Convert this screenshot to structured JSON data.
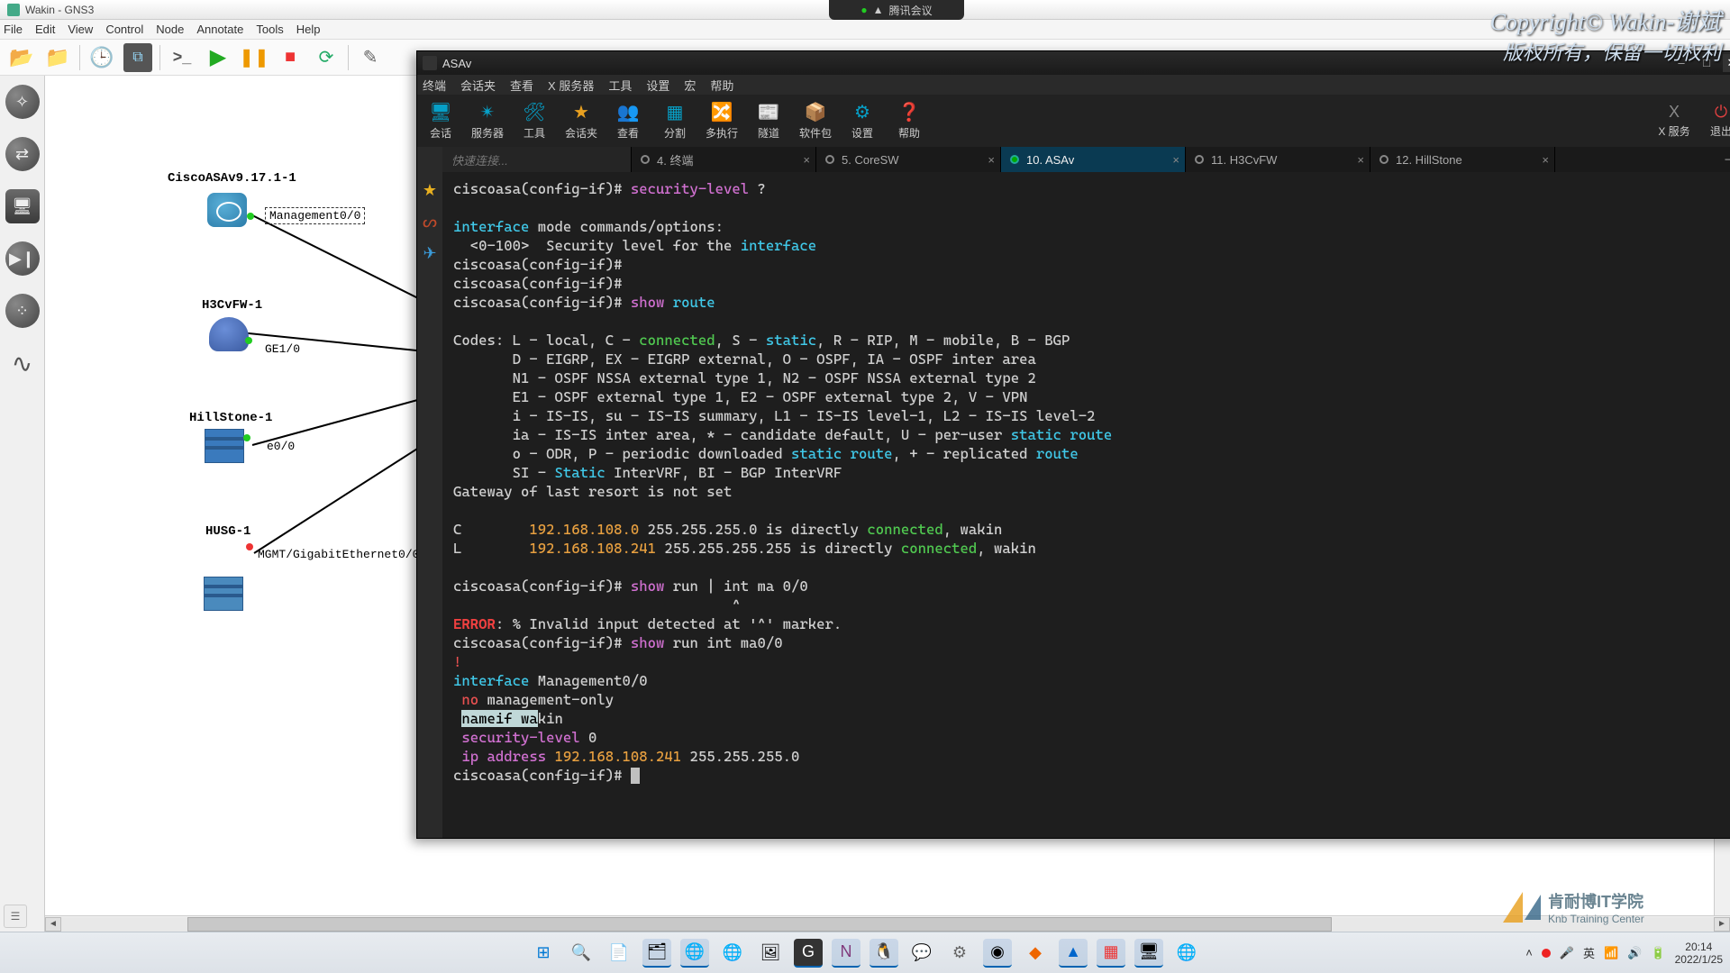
{
  "gns3": {
    "title": "Wakin - GNS3",
    "menu": [
      "File",
      "Edit",
      "View",
      "Control",
      "Node",
      "Annotate",
      "Tools",
      "Help"
    ]
  },
  "canvas": {
    "asa_label": "CiscoASAv9.17.1-1",
    "asa_port": "Management0/0",
    "h3c_label": "H3CvFW-1",
    "h3c_port": "GE1/0",
    "hs_label": "HillStone-1",
    "hs_port": "e0/0",
    "husg_label": "HUSG-1",
    "husg_port": "MGMT/GigabitEthernet0/0"
  },
  "terminal": {
    "title": "ASAv",
    "menubar": [
      "终端",
      "会话夹",
      "查看",
      "X 服务器",
      "工具",
      "设置",
      "宏",
      "帮助"
    ],
    "tools": [
      {
        "icon": "🖥",
        "label": "会话"
      },
      {
        "icon": "✴",
        "label": "服务器"
      },
      {
        "icon": "🛠",
        "label": "工具"
      },
      {
        "icon": "★",
        "label": "会话夹",
        "orange": true
      },
      {
        "icon": "👥",
        "label": "查看",
        "white": true
      },
      {
        "icon": "▦",
        "label": "分割"
      },
      {
        "icon": "🔀",
        "label": "多执行"
      },
      {
        "icon": "📰",
        "label": "隧道"
      },
      {
        "icon": "📦",
        "label": "软件包"
      },
      {
        "icon": "⚙",
        "label": "设置"
      },
      {
        "icon": "❓",
        "label": "帮助"
      }
    ],
    "right_tools": [
      {
        "icon": "X",
        "label": "X 服务",
        "cls": "gray"
      },
      {
        "icon": "⏻",
        "label": "退出",
        "cls": "red"
      }
    ],
    "quick_connect": "快速连接...",
    "tabs": [
      {
        "label": "4. 终端"
      },
      {
        "label": "5. CoreSW"
      },
      {
        "label": "10. ASAv",
        "active": true
      },
      {
        "label": "11. H3CvFW"
      },
      {
        "label": "12. HillStone"
      }
    ],
    "prompt": "ciscoasa(config-if)# "
  },
  "top": {
    "meeting": "腾讯会议",
    "copyright1": "Copyright© Wakin-谢斌",
    "copyright2": "版权所有，保留一切权利"
  },
  "knb": {
    "cn": "肯耐博IT学院",
    "en": "Knb Training Center"
  },
  "tray": {
    "ime": "英",
    "time": "20:14",
    "date": "2022/1/25"
  }
}
